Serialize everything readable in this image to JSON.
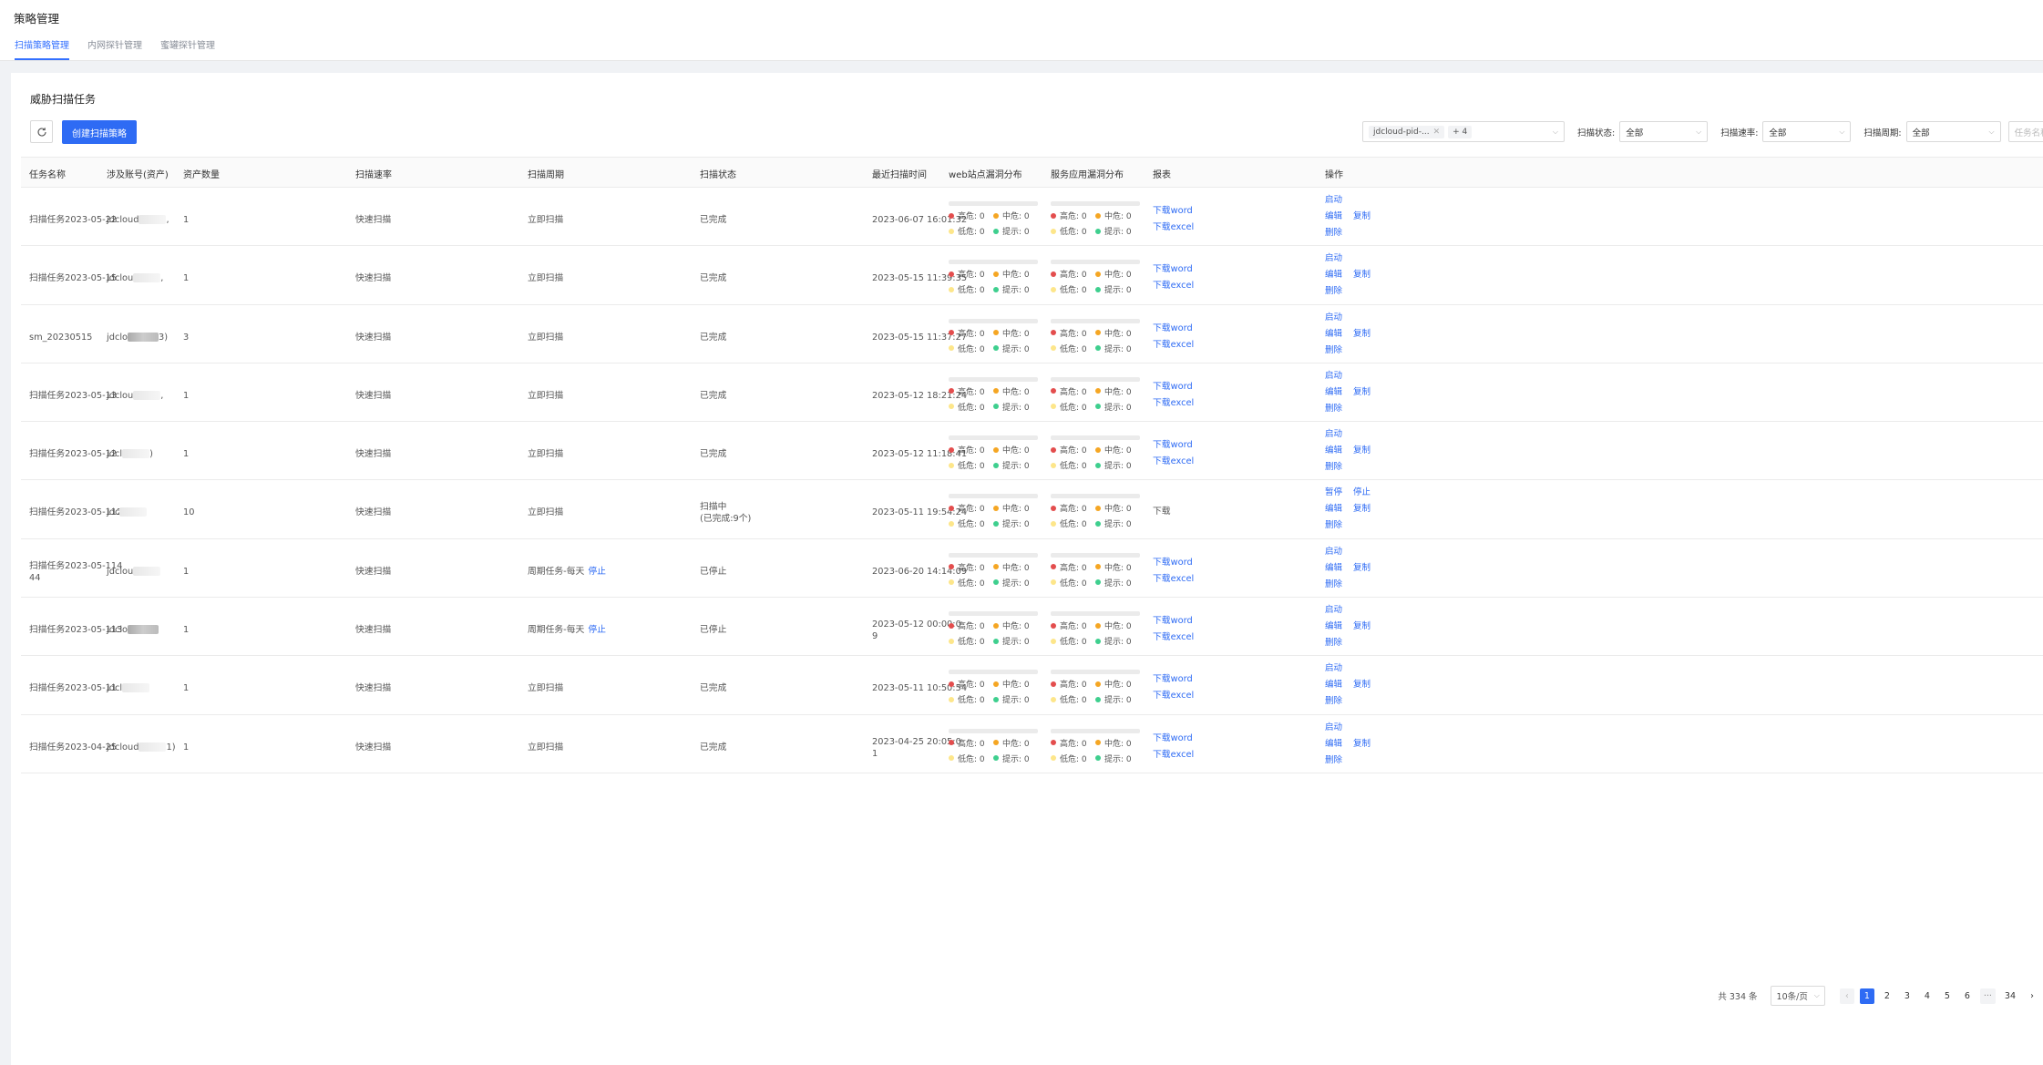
{
  "page": {
    "title": "策略管理",
    "tabs": [
      {
        "label": "扫描策略管理",
        "active": true
      },
      {
        "label": "内网探针管理",
        "active": false
      },
      {
        "label": "蜜罐探针管理",
        "active": false
      }
    ]
  },
  "section": {
    "title": "威胁扫描任务",
    "create_label": "创建扫描策略",
    "refresh_icon": "refresh-icon"
  },
  "filters": {
    "account_tag": "jdcloud-pid-...",
    "account_more": "+ 4",
    "status_label": "扫描状态:",
    "status_value": "全部",
    "rate_label": "扫描速率:",
    "rate_value": "全部",
    "cycle_label": "扫描周期:",
    "cycle_value": "全部",
    "search_placeholder": "任务名称"
  },
  "table": {
    "columns": [
      "任务名称",
      "涉及账号(资产)",
      "资产数量",
      "扫描速率",
      "扫描周期",
      "扫描状态",
      "最近扫描时间",
      "web站点漏洞分布",
      "服务应用漏洞分布",
      "报表",
      "操作"
    ],
    "vuln_labels": {
      "high": "高危: 0",
      "mid": "中危: 0",
      "low": "低危: 0",
      "info": "提示: 0"
    },
    "colors": {
      "high": "#e34d4d",
      "mid": "#f5a623",
      "low": "#fde68a",
      "info": "#3ecf8e",
      "link": "#2e6bf4"
    },
    "rows": [
      {
        "name": [
          "扫描任务2023-05-22"
        ],
        "account": "jdcloud",
        "account_tail": ",",
        "count": "1",
        "rate": "快速扫描",
        "cycle": "立即扫描",
        "cycle_link": "",
        "status": [
          "已完成"
        ],
        "time": [
          "2023-06-07 16:01:32"
        ],
        "report": [
          "下载word",
          "下载excel"
        ],
        "report_link": true,
        "ops_first": [
          "启动"
        ]
      },
      {
        "name": [
          "扫描任务2023-05-15"
        ],
        "account": "jdclou",
        "account_tail": ",",
        "count": "1",
        "rate": "快速扫描",
        "cycle": "立即扫描",
        "cycle_link": "",
        "status": [
          "已完成"
        ],
        "time": [
          "2023-05-15 11:39:35"
        ],
        "report": [
          "下载word",
          "下载excel"
        ],
        "report_link": true,
        "ops_first": [
          "启动"
        ]
      },
      {
        "name": [
          "sm_20230515"
        ],
        "account": "jdclo",
        "account_tail": "3)",
        "count": "3",
        "rate": "快速扫描",
        "cycle": "立即扫描",
        "cycle_link": "",
        "status": [
          "已完成"
        ],
        "time": [
          "2023-05-15 11:37:27"
        ],
        "report": [
          "下载word",
          "下载excel"
        ],
        "report_link": true,
        "ops_first": [
          "启动"
        ]
      },
      {
        "name": [
          "扫描任务2023-05-13"
        ],
        "account": "jdclou",
        "account_tail": ",",
        "count": "1",
        "rate": "快速扫描",
        "cycle": "立即扫描",
        "cycle_link": "",
        "status": [
          "已完成"
        ],
        "time": [
          "2023-05-12 18:21:24"
        ],
        "report": [
          "下载word",
          "下载excel"
        ],
        "report_link": true,
        "ops_first": [
          "启动"
        ]
      },
      {
        "name": [
          "扫描任务2023-05-12"
        ],
        "account": "jdcl",
        "account_tail": ")",
        "count": "1",
        "rate": "快速扫描",
        "cycle": "立即扫描",
        "cycle_link": "",
        "status": [
          "已完成"
        ],
        "time": [
          "2023-05-12 11:18:41"
        ],
        "report": [
          "下载word",
          "下载excel"
        ],
        "report_link": true,
        "ops_first": [
          "启动"
        ]
      },
      {
        "name": [
          "扫描任务2023-05-112"
        ],
        "account": "jdc",
        "account_tail": "",
        "count": "10",
        "rate": "快速扫描",
        "cycle": "立即扫描",
        "cycle_link": "",
        "status": [
          "扫描中",
          "(已完成:9个)"
        ],
        "time": [
          "2023-05-11 19:54:24"
        ],
        "report": [
          "下载"
        ],
        "report_link": false,
        "ops_first": [
          "暂停",
          "停止"
        ]
      },
      {
        "name": [
          "扫描任务2023-05-114",
          "44"
        ],
        "account": "jdclou",
        "account_tail": "",
        "count": "1",
        "rate": "快速扫描",
        "cycle": "周期任务-每天",
        "cycle_link": "停止",
        "status": [
          "已停止"
        ],
        "time": [
          "2023-06-20 14:14:09"
        ],
        "report": [
          "下载word",
          "下载excel"
        ],
        "report_link": true,
        "ops_first": [
          "启动"
        ]
      },
      {
        "name": [
          "扫描任务2023-05-113"
        ],
        "account": "jdclo",
        "account_tail": "",
        "count": "1",
        "rate": "快速扫描",
        "cycle": "周期任务-每天",
        "cycle_link": "停止",
        "status": [
          "已停止"
        ],
        "time": [
          "2023-05-12 00:00:0",
          "9"
        ],
        "report": [
          "下载word",
          "下载excel"
        ],
        "report_link": true,
        "ops_first": [
          "启动"
        ]
      },
      {
        "name": [
          "扫描任务2023-05-11"
        ],
        "account": "jdcl",
        "account_tail": "",
        "count": "1",
        "rate": "快速扫描",
        "cycle": "立即扫描",
        "cycle_link": "",
        "status": [
          "已完成"
        ],
        "time": [
          "2023-05-11 10:50:54"
        ],
        "report": [
          "下载word",
          "下载excel"
        ],
        "report_link": true,
        "ops_first": [
          "启动"
        ]
      },
      {
        "name": [
          "扫描任务2023-04-25"
        ],
        "account": "jdcloud",
        "account_tail": "1)",
        "count": "1",
        "rate": "快速扫描",
        "cycle": "立即扫描",
        "cycle_link": "",
        "status": [
          "已完成"
        ],
        "time": [
          "2023-04-25 20:05:0",
          "1"
        ],
        "report": [
          "下载word",
          "下载excel"
        ],
        "report_link": true,
        "ops_first": [
          "启动"
        ]
      }
    ],
    "ops_edit": "编辑",
    "ops_copy": "复制",
    "ops_delete": "删除"
  },
  "pagination": {
    "total": "共 334 条",
    "page_size": "10条/页",
    "pages": [
      "1",
      "2",
      "3",
      "4",
      "5",
      "6",
      "···",
      "34"
    ],
    "current": "1",
    "prev_icon": "chevron-left-icon",
    "next_icon": "chevron-right-icon"
  }
}
